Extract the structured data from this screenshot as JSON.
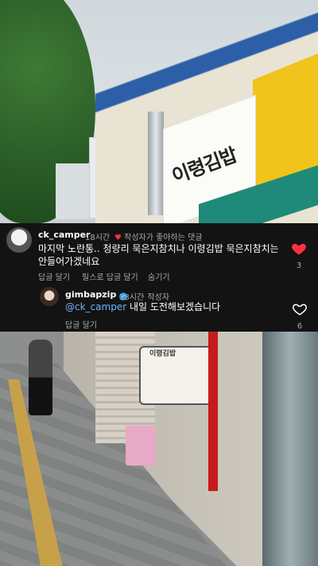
{
  "photo_top": {
    "sign_text": "이령김밥"
  },
  "comments": [
    {
      "username": "ck_camper",
      "time": "18시간",
      "liked_by_author": "작성자가 좋아하는 댓글",
      "text_line1": "마지막 노란통.. 청량리 묵은지참치나 이령김밥 묵은지참치는",
      "text_line2": "안들어가겠네요",
      "reply": "답글 달기",
      "see_translation": "릴스로 답글 달기",
      "hide": "숨기기",
      "like_count": "3",
      "heart_color": "#ff3040"
    },
    {
      "username": "gimbapzip",
      "time": "18시간",
      "author_tag": "작성자",
      "mention": "@ck_camper",
      "text": " 내일 도전해보겠습니다",
      "reply": "답글 달기",
      "like_count": "6"
    }
  ],
  "photo_bottom": {
    "menu_board_title": "이령김밥"
  },
  "icons": [
    "heart-filled-icon",
    "heart-outline-icon",
    "verified-badge-icon",
    "small-heart-icon"
  ]
}
